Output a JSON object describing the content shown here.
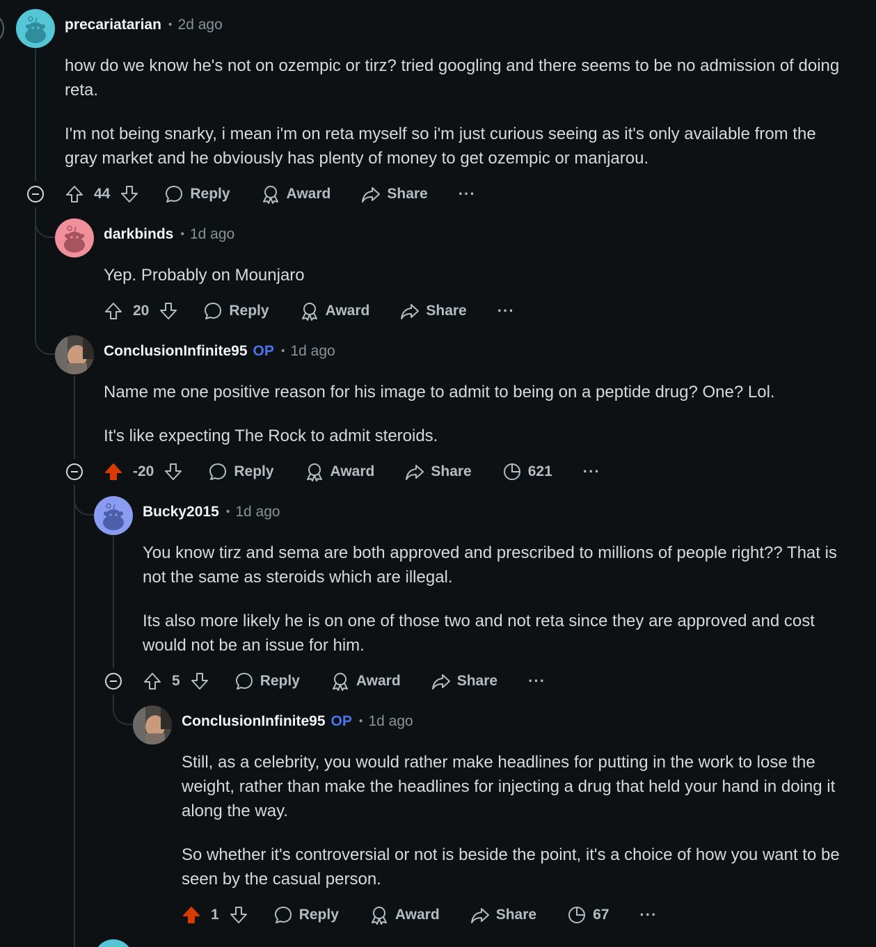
{
  "comments": [
    {
      "username": "precariatarian",
      "time": "2d ago",
      "paragraphs": [
        "how do we know he's not on ozempic or tirz? tried googling and there seems to be no admission of doing reta.",
        "I'm not being snarky, i mean i'm on reta myself so i'm just curious seeing as it's only available from the gray market and he obviously has plenty of money to get ozempic or manjarou."
      ],
      "score": "44"
    },
    {
      "username": "darkbinds",
      "time": "1d ago",
      "paragraphs": [
        "Yep. Probably on Mounjaro"
      ],
      "score": "20"
    },
    {
      "username": "ConclusionInfinite95",
      "op_badge": "OP",
      "time": "1d ago",
      "paragraphs": [
        "Name me one positive reason for his image to admit to being on a peptide drug? One? Lol.",
        "It's like expecting The Rock to admit steroids."
      ],
      "score": "-20",
      "insights": "621"
    },
    {
      "username": "Bucky2015",
      "time": "1d ago",
      "paragraphs": [
        "You know tirz and sema are both approved and prescribed to millions of people right?? That is not the same as steroids which are illegal.",
        "Its also more likely he is on one of those two and not reta since they are approved and cost would not be an issue for him."
      ],
      "score": "5"
    },
    {
      "username": "ConclusionInfinite95",
      "op_badge": "OP",
      "time": "1d ago",
      "paragraphs": [
        "Still, as a celebrity, you would rather make headlines for putting in the work to lose the weight, rather than make the headlines for injecting a drug that held your hand in doing it along the way.",
        "So whether it's controversial or not is beside the point, it's a choice of how you want to be seen by the casual person."
      ],
      "score": "1",
      "insights": "67"
    }
  ],
  "labels": {
    "reply": "Reply",
    "award": "Award",
    "share": "Share",
    "more": "···",
    "separator": "•"
  },
  "colors": {
    "background": "#0e1113",
    "upvoted": "#d93a00",
    "op_badge": "#4d73ea",
    "thread_line": "#2a3236"
  },
  "icons": [
    "snoo-avatar-icon",
    "photo-avatar-icon",
    "upvote-icon",
    "downvote-icon",
    "reply-icon",
    "award-icon",
    "share-icon",
    "insights-icon",
    "collapse-icon",
    "more-icon"
  ]
}
